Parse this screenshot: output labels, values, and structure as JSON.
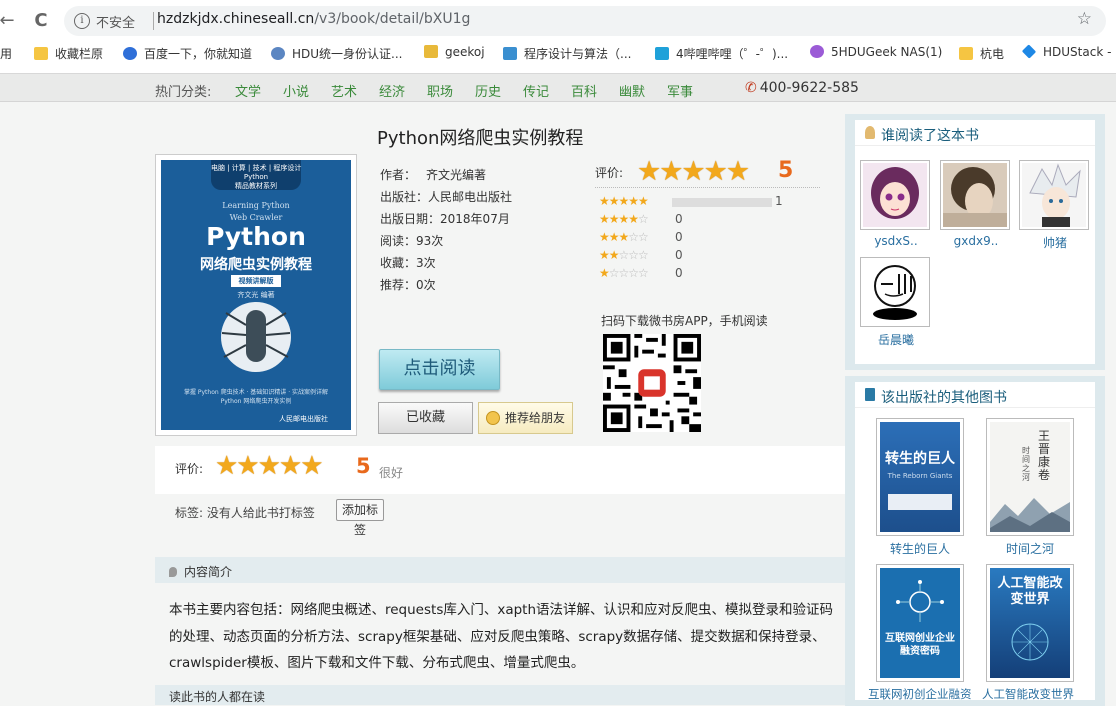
{
  "browser": {
    "back_icon": "←",
    "reload_icon": "C",
    "insecure_label": "不安全",
    "host": "hzdzkjdx.chineseall.cn",
    "path": "/v3/book/detail/bXU1g",
    "star_icon": "☆"
  },
  "bookmarks": [
    {
      "label": "应用",
      "color": "#4285f4"
    },
    {
      "label": "收藏栏原",
      "color": "#f5c542"
    },
    {
      "label": "百度一下，你就知道",
      "color": "#2f6fd8"
    },
    {
      "label": "HDU统一身份认证...",
      "color": "#5b86c2"
    },
    {
      "label": "geekoj",
      "color": "#e8b93a"
    },
    {
      "label": "程序设计与算法（...",
      "color": "#3a8fd0"
    },
    {
      "label": "4哔哩哔哩（゜-゜)...",
      "color": "#1fa1d9"
    },
    {
      "label": "5HDUGeek NAS(1)",
      "color": "#9b5bd6"
    },
    {
      "label": "杭电",
      "color": "#f5c542"
    },
    {
      "label": "HDUStack -",
      "color": "#1e88e5"
    }
  ],
  "topnav": {
    "hot_label": "热门分类:",
    "categories": [
      "文学",
      "小说",
      "艺术",
      "经济",
      "职场",
      "历史",
      "传记",
      "百科",
      "幽默",
      "军事"
    ],
    "phone_icon": "✆",
    "phone": "400-9622-585"
  },
  "book": {
    "title": "Python网络爬虫实例教程",
    "author_label": "作者：",
    "author": "齐文光编著",
    "publisher_label": "出版社：",
    "publisher": "人民邮电出版社",
    "date_label": "出版日期：",
    "date": "2018年07月",
    "reads_label": "阅读：",
    "reads": "93次",
    "favs_label": "收藏：",
    "favs": "3次",
    "recs_label": "推荐：",
    "recs": "0次"
  },
  "cover": {
    "band": "电脑 | 计算 | 技术 | 程序设计\nPython\n精品教材系列",
    "en1": "Learning Python",
    "en2": "Web Crawler",
    "py": "Python",
    "cn": "网络爬虫实例教程",
    "tag": "视频讲解版",
    "author": "齐文光 编著",
    "foot": "掌握 Python 爬虫技术 · 基础知识精讲 · 实战案例详解\nPython 网络爬虫开发实例",
    "publisher_mark": "人民邮电出版社"
  },
  "rating": {
    "label": "评价:",
    "score": "5",
    "stars": 5,
    "distribution": [
      {
        "stars": 5,
        "count": "1",
        "fraction": 1.0
      },
      {
        "stars": 4,
        "count": "0",
        "fraction": 0
      },
      {
        "stars": 3,
        "count": "0",
        "fraction": 0
      },
      {
        "stars": 2,
        "count": "0",
        "fraction": 0
      },
      {
        "stars": 1,
        "count": "0",
        "fraction": 0
      }
    ]
  },
  "qr": {
    "label": "扫码下载微书房APP，手机阅读"
  },
  "actions": {
    "read": "点击阅读",
    "favorited": "已收藏",
    "recommend": "推荐给朋友"
  },
  "rating_box": {
    "label": "评价:",
    "score": "5",
    "desc": "很好"
  },
  "tags": {
    "label": "标签: 没有人给此书打标签",
    "add": "添加标签"
  },
  "intro": {
    "header": "内容简介",
    "text": "本书主要内容包括：网络爬虫概述、requests库入门、xapth语法详解、认识和应对反爬虫、模拟登录和验证码的处理、动态页面的分析方法、scrapy框架基础、应对反爬虫策略、scrapy数据存储、提交数据和保持登录、crawlspider模板、图片下载和文件下载、分布式爬虫、增量式爬虫。",
    "next_header": "读此书的人都在读"
  },
  "readers": {
    "header": "谁阅读了这本书",
    "items": [
      {
        "name": "ysdxS.."
      },
      {
        "name": "gxdx9.."
      },
      {
        "name": "帅猪"
      },
      {
        "name": "岳晨曦"
      }
    ]
  },
  "publisher_books": {
    "header": "该出版社的其他图书",
    "items": [
      {
        "name": "转生的巨人",
        "cover_title": "转生的巨人",
        "cover_sub": "The Reborn Giants",
        "color": "#2c6fb8"
      },
      {
        "name": "时间之河",
        "cover_title": "王晋康卷",
        "cover_sub": "时间之河",
        "color": "#f4f4f2"
      },
      {
        "name": "互联网初创企业融资",
        "cover_title": "互联网创业企业融资密码",
        "cover_sub": "",
        "color": "#1b6fb0"
      },
      {
        "name": "人工智能改变世界",
        "cover_title": "人工智能改变世界",
        "cover_sub": "",
        "color": "#1b5a9a"
      }
    ]
  }
}
